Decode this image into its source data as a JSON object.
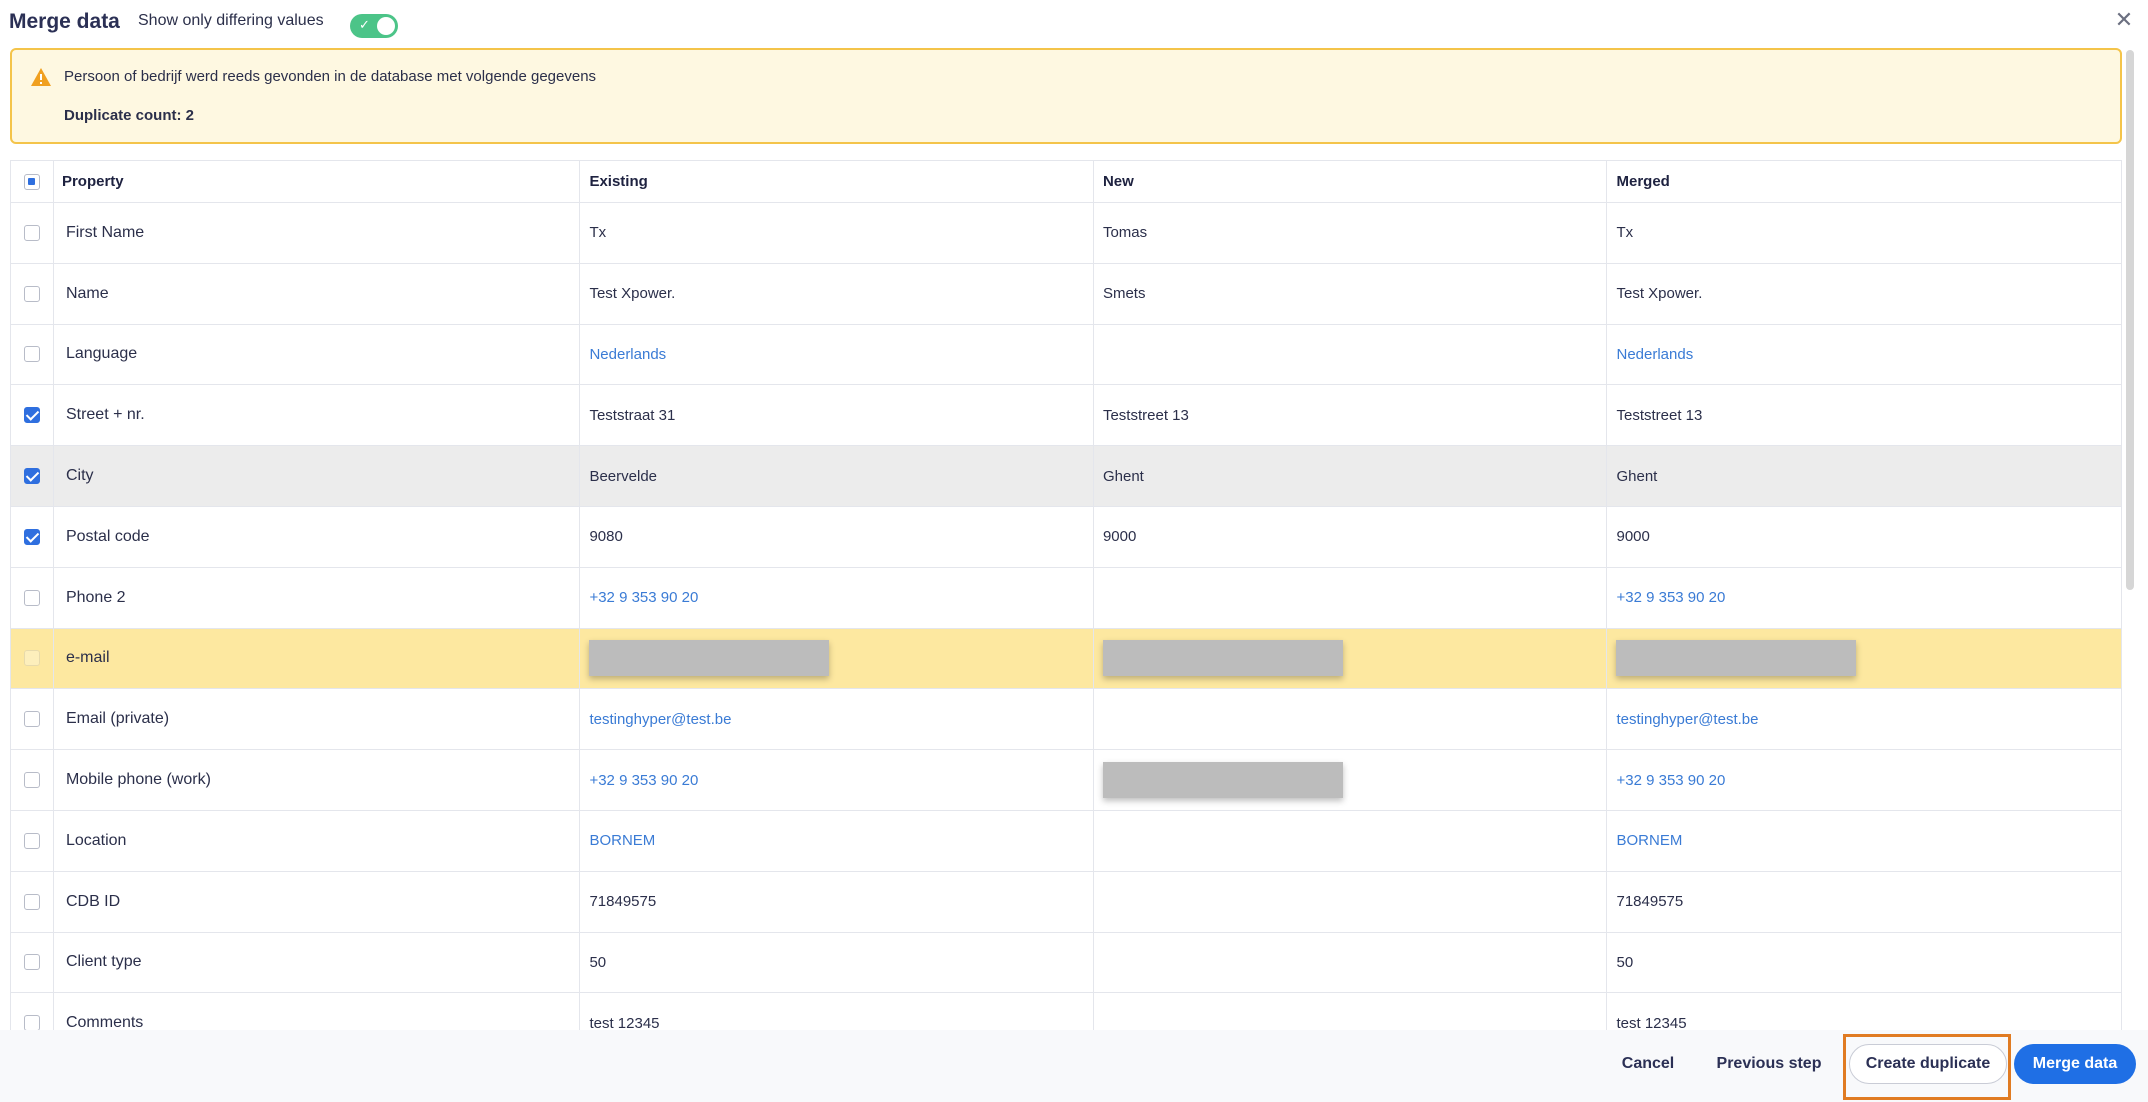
{
  "header": {
    "title": "Merge data",
    "toggle_label": "Show only differing values",
    "toggle_on": true
  },
  "alert": {
    "message": "Persoon of bedrijf werd reeds gevonden in de database met volgende gegevens",
    "duplicate_count": "Duplicate count: 2"
  },
  "table": {
    "columns": [
      "Property",
      "Existing",
      "New",
      "Merged"
    ],
    "rows": [
      {
        "property": "First Name",
        "existing": "Tx",
        "new": "Tomas",
        "merged": "Tx"
      },
      {
        "property": "Name",
        "existing": "Test Xpower.",
        "new": "Smets",
        "merged": "Test Xpower."
      },
      {
        "property": "Language",
        "existing": "Nederlands",
        "new": "",
        "merged": "Nederlands"
      },
      {
        "property": "Street + nr.",
        "existing": "Teststraat 31",
        "new": "Teststreet 13",
        "merged": "Teststreet 13"
      },
      {
        "property": "City",
        "existing": "Beervelde",
        "new": "Ghent",
        "merged": "Ghent"
      },
      {
        "property": "Postal code",
        "existing": "9080",
        "new": "9000",
        "merged": "9000"
      },
      {
        "property": "Phone 2",
        "existing": "+32 9 353 90 20",
        "new": "",
        "merged": "+32 9 353 90 20"
      },
      {
        "property": "e-mail",
        "existing": "",
        "new": "",
        "merged": ""
      },
      {
        "property": "Email (private)",
        "existing": "testinghyper@test.be",
        "new": "",
        "merged": "testinghyper@test.be"
      },
      {
        "property": "Mobile phone (work)",
        "existing": "+32 9 353 90 20",
        "new": "",
        "merged": "+32 9 353 90 20"
      },
      {
        "property": "Location",
        "existing": "BORNEM",
        "new": "",
        "merged": "BORNEM"
      },
      {
        "property": "CDB ID",
        "existing": "71849575",
        "new": "",
        "merged": "71849575"
      },
      {
        "property": "Client type",
        "existing": "50",
        "new": "",
        "merged": "50"
      },
      {
        "property": "Comments",
        "existing": "test 12345",
        "new": "",
        "merged": "test 12345"
      }
    ]
  },
  "footer": {
    "cancel": "Cancel",
    "previous": "Previous step",
    "create_duplicate": "Create duplicate",
    "merge": "Merge data"
  },
  "colors": {
    "accent": "#1f6fe5",
    "toggle": "#4cc488",
    "alert_bg": "#fef8e1",
    "alert_border": "#f4c44a",
    "highlight_row": "#fde8a0",
    "focus_outline": "#e07b22"
  }
}
